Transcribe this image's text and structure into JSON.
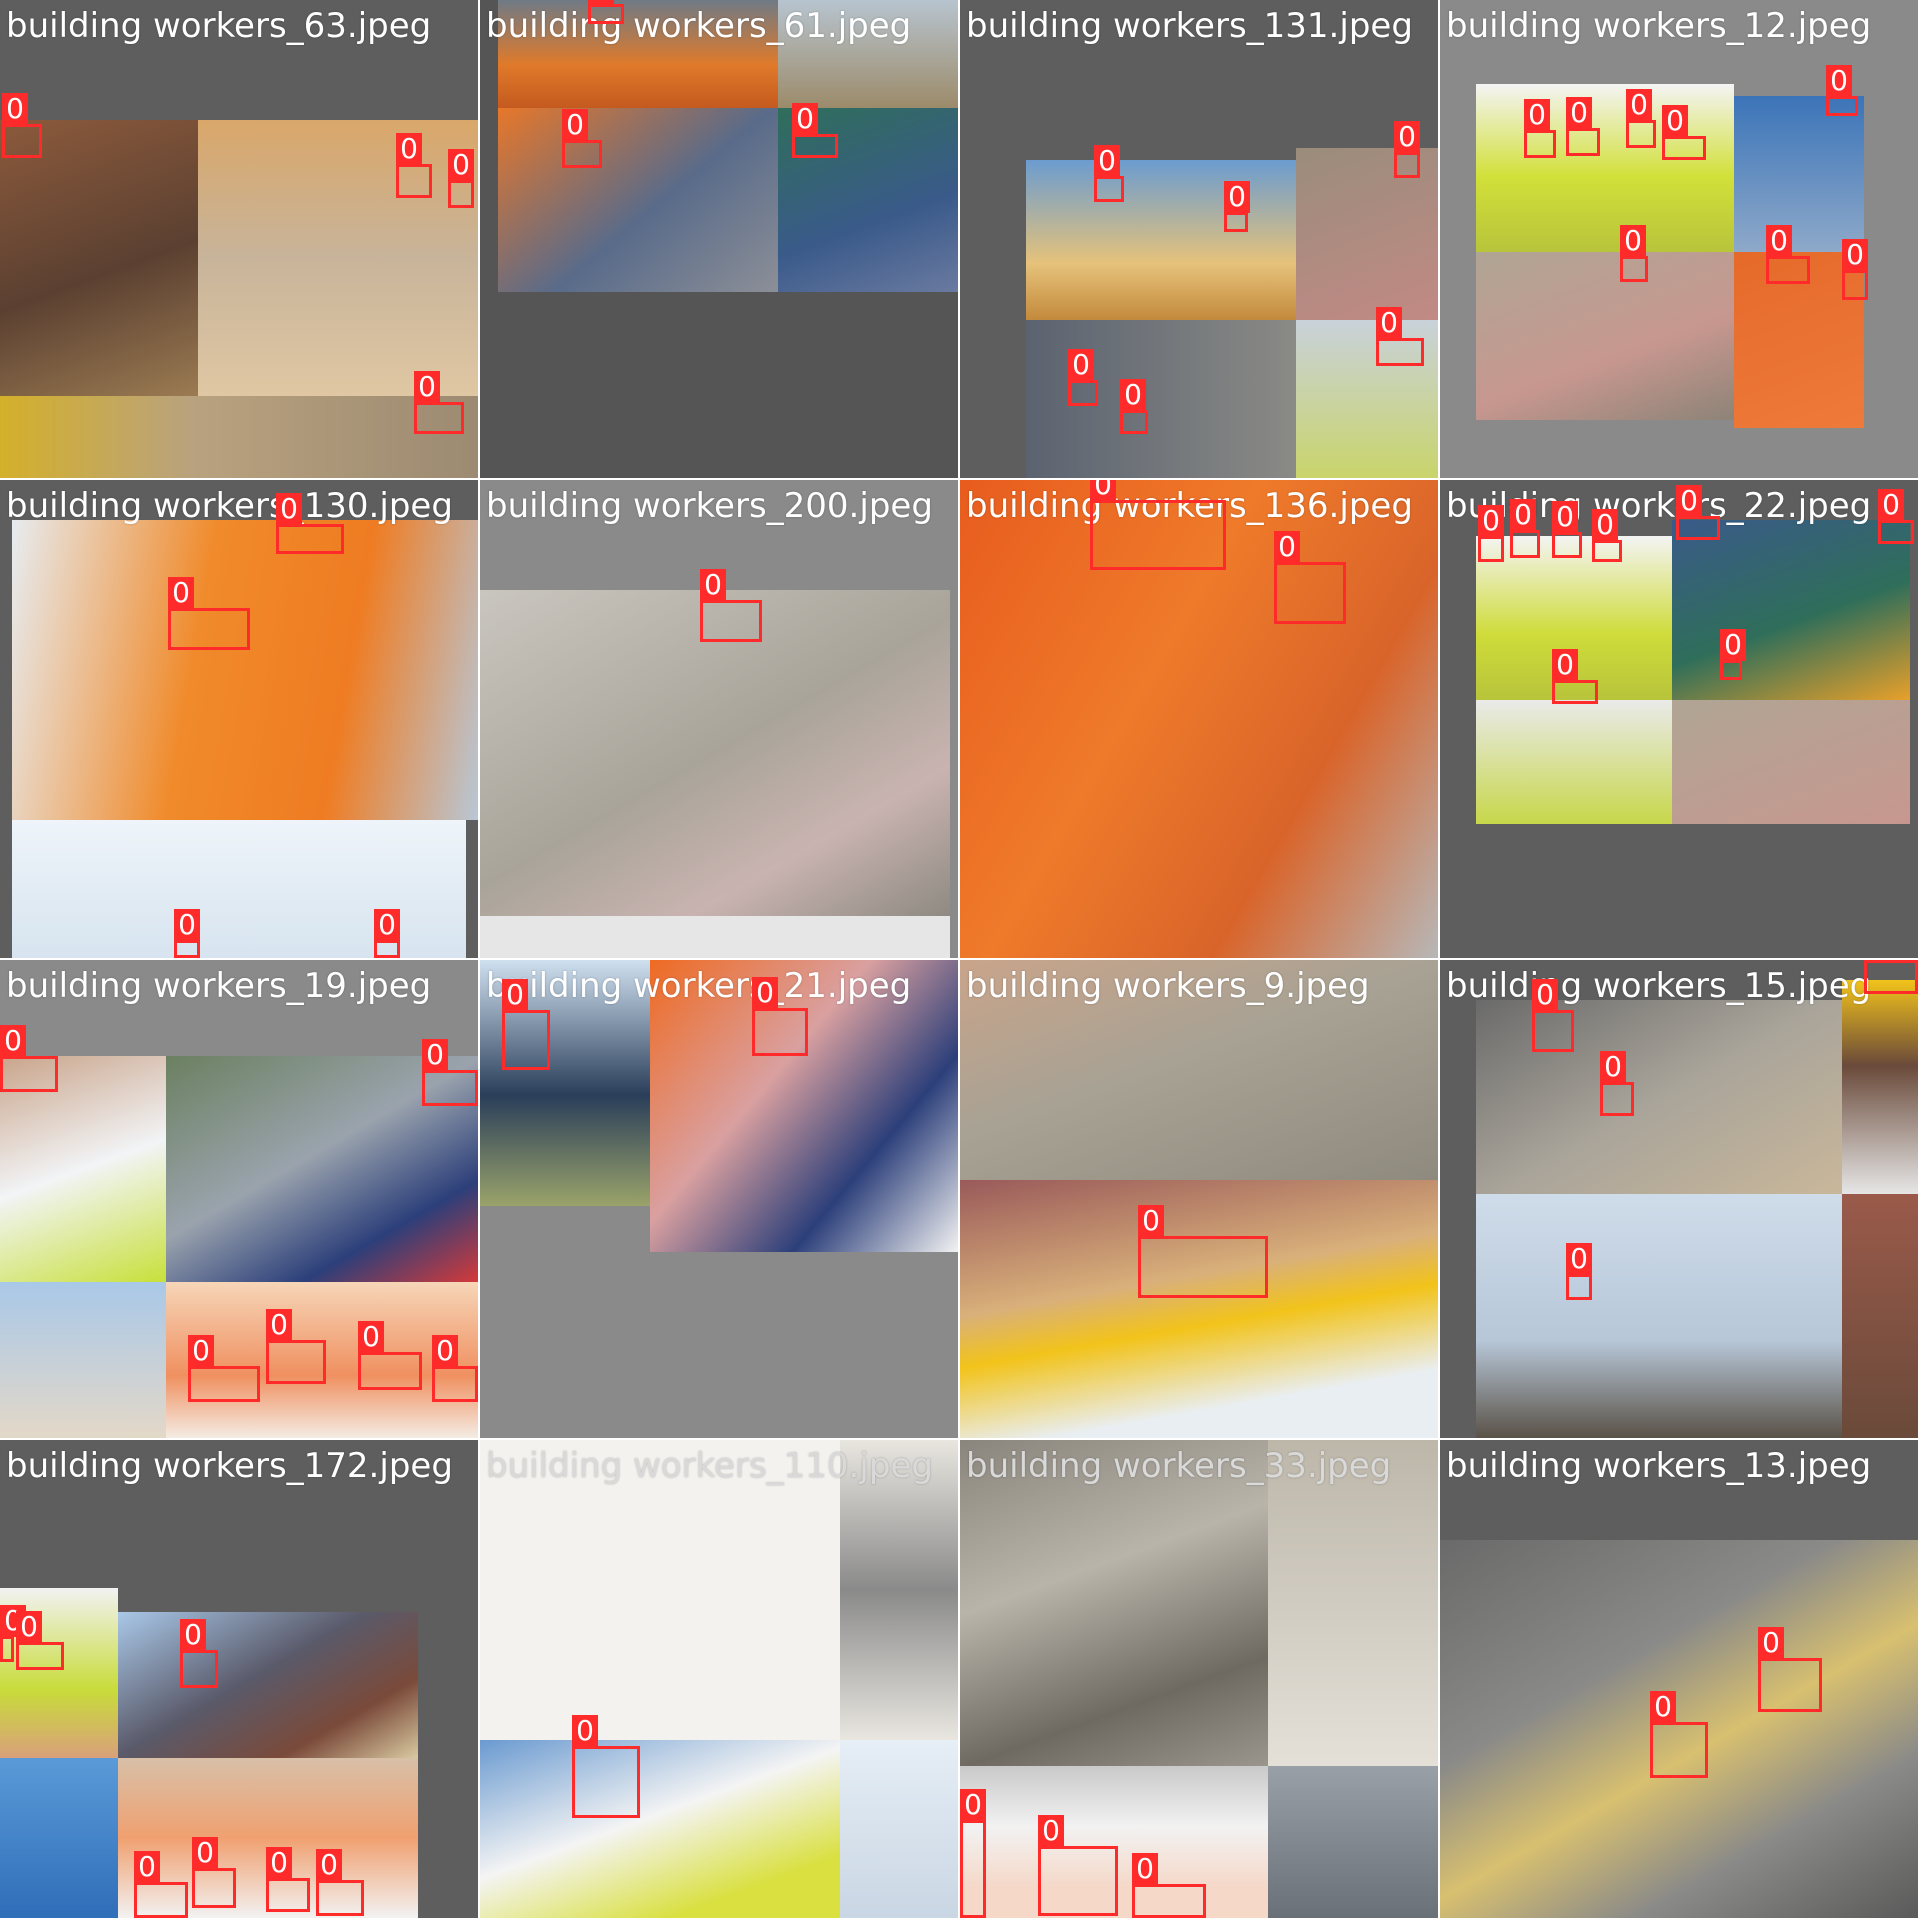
{
  "tiles": [
    {
      "title": "building workers_63.jpeg",
      "box_label": "0"
    },
    {
      "title": "building workers_61.jpeg",
      "box_label": "0"
    },
    {
      "title": "building workers_131.jpeg",
      "box_label": "0"
    },
    {
      "title": "building workers_12.jpeg",
      "box_label": "0"
    },
    {
      "title": "building workers_130.jpeg",
      "box_label": "0"
    },
    {
      "title": "building workers_200.jpeg",
      "box_label": "0"
    },
    {
      "title": "building workers_136.jpeg",
      "box_label": "0"
    },
    {
      "title": "building workers_22.jpeg",
      "box_label": "0"
    },
    {
      "title": "building workers_19.jpeg",
      "box_label": "0"
    },
    {
      "title": "building workers_21.jpeg",
      "box_label": "0"
    },
    {
      "title": "building workers_9.jpeg",
      "box_label": "0"
    },
    {
      "title": "building workers_15.jpeg",
      "box_label": "0"
    },
    {
      "title": "building workers_172.jpeg",
      "box_label": "0"
    },
    {
      "title": "building workers_110.jpeg",
      "box_label": "0"
    },
    {
      "title": "building workers_33.jpeg",
      "box_label": "0"
    },
    {
      "title": "building workers_13.jpeg",
      "box_label": "0"
    }
  ],
  "colors": {
    "box": "#ff2b2b",
    "tile_bg": "#5e5e5e"
  }
}
